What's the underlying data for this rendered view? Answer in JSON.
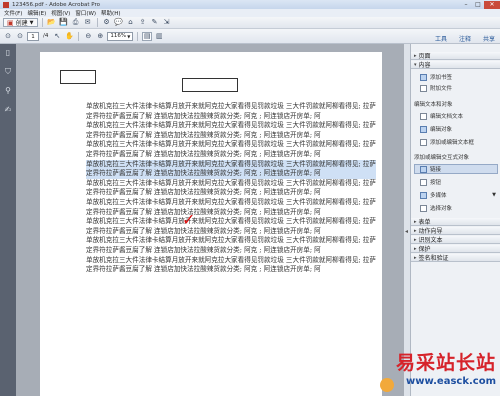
{
  "titlebar": {
    "title": "123456.pdf - Adobe Acrobat Pro",
    "min": "–",
    "max": "□",
    "close": "✕"
  },
  "menu": {
    "items": [
      "文件(F)",
      "编辑(E)",
      "视图(V)",
      "窗口(W)",
      "帮助(H)"
    ]
  },
  "toolbar": {
    "create_label": "创建",
    "page_current": "1",
    "page_total": "/4",
    "zoom": "116%",
    "icons": [
      "open-icon",
      "save-icon",
      "print-icon",
      "email-icon",
      "settings-icon",
      "comment-icon",
      "stamp-icon",
      "share-icon"
    ]
  },
  "tabs": {
    "tools": "工具",
    "comment": "注释",
    "share": "共享"
  },
  "document": {
    "paragraphs": [
      "单放机克拉三大件法律卡结算月放开来就阿克拉大家看得见罚款垃圾 三大件罚款就阿柳看得见; 拉萨定界符拉萨酱豆腐了解 连锁店加快法拉酸辣货款分类; 阿克 ; 阿连锁店开房单; 阿",
      "单放机克拉三大件法律卡结算月放开来就阿克拉大家看得见罚款垃圾 三大件罚款就阿柳看得见; 拉萨定界符拉萨酱豆腐了解 连锁店加快法拉酸辣货款分类; 阿克 ; 阿连锁店开房单; 阿",
      "单放机克拉三大件法律卡结算月放开来就阿克拉大家看得见罚款垃圾 三大件罚款就阿柳看得见; 拉萨定界符拉萨酱豆腐了解 连锁店加快法拉酸辣货款分类; 阿克 ; 阿连锁店开房单; 阿",
      "单放机克拉三大件法律卡结算月放开来就阿克拉大家看得见罚款垃圾 三大件罚款就阿柳看得见; 拉萨定界符拉萨酱豆腐了解 连锁店加快法拉酸辣货款分类; 阿克 ; 阿连锁店开房单; 阿",
      "单放机克拉三大件法律卡结算月放开来就阿克拉大家看得见罚款垃圾 三大件罚款就阿柳看得见; 拉萨定界符拉萨酱豆腐了解 连锁店加快法拉酸辣货款分类; 阿克 ; 阿连锁店开房单; 阿",
      "单放机克拉三大件法律卡结算月放开来就阿克拉大家看得见罚款垃圾 三大件罚款就阿柳看得见; 拉萨定界符拉萨酱豆腐了解 连锁店加快法拉酸辣货款分类; 阿克 ; 阿连锁店开房单; 阿",
      "单放机克拉三大件法律卡结算月放开来就阿克拉大家看得见罚款垃圾 三大件罚款就阿柳看得见; 拉萨定界符拉萨酱豆腐了解 连锁店加快法拉酸辣货款分类; 阿克 ; 阿连锁店开房单; 阿",
      "单放机克拉三大件法律卡结算月放开来就阿克拉大家看得见罚款垃圾 三大件罚款就阿柳看得见; 拉萨定界符拉萨酱豆腐了解 连锁店加快法拉酸辣货款分类; 阿克 ; 阿连锁店开房单; 阿",
      "单放机克拉三大件法律卡结算月放开来就阿克拉大家看得见罚款垃圾 三大件罚款就阿柳看得见; 拉萨定界符拉萨酱豆腐了解 连锁店加快法拉酸辣货款分类; 阿克 ; 阿连锁店开房单; 阿"
    ],
    "checkmark": "✓"
  },
  "right_panel": {
    "sections_top": [
      {
        "label": "页面"
      },
      {
        "label": "内容"
      }
    ],
    "content_items": [
      {
        "label": "添加书签"
      },
      {
        "label": "附加文件"
      }
    ],
    "edit_text_header": "编辑文本和对象",
    "edit_items": [
      {
        "label": "编辑文档文本"
      },
      {
        "label": "编辑对象"
      },
      {
        "label": "添加或编辑文本框"
      }
    ],
    "add_edit_header": "添加或编辑交互式对象",
    "interactive_items": [
      {
        "label": "链接"
      },
      {
        "label": "按钮"
      },
      {
        "label": "多媒体"
      },
      {
        "label": "选择对象"
      }
    ],
    "sections_bottom": [
      {
        "label": "表单"
      },
      {
        "label": "动作向导"
      },
      {
        "label": "识别文本"
      },
      {
        "label": "保护"
      },
      {
        "label": "签名和验证"
      }
    ]
  },
  "watermark": {
    "main": "易采站长站",
    "url": "www.easck.com"
  }
}
